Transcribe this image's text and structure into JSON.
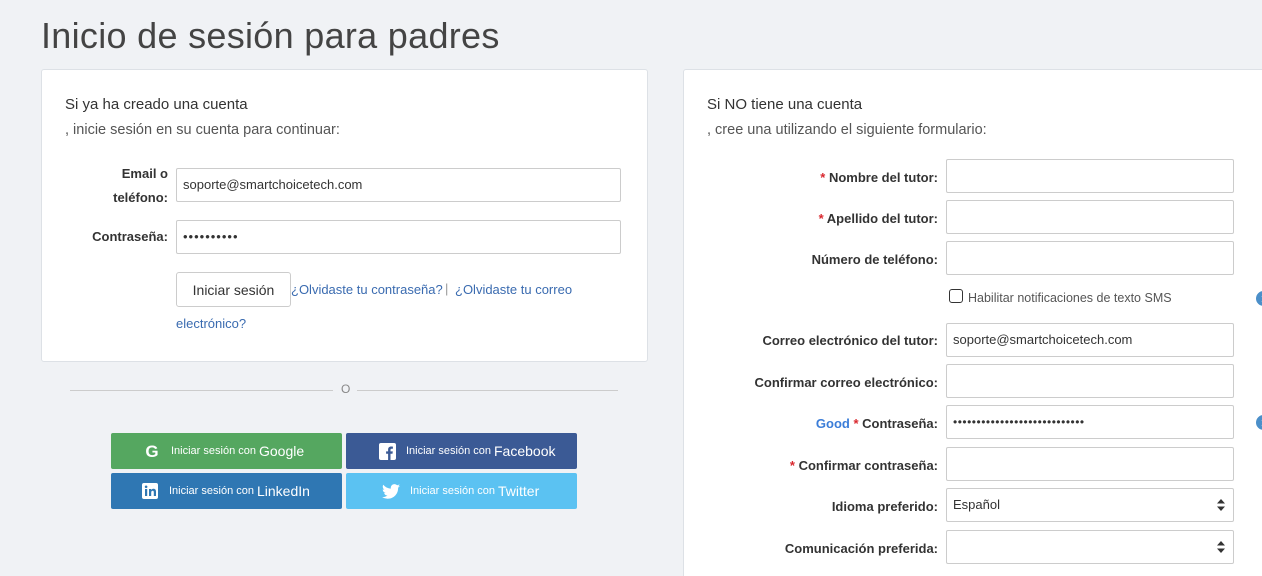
{
  "page": {
    "title": "Inicio de sesión para padres"
  },
  "login": {
    "intro_line1": "Si ya ha creado una cuenta",
    "intro_line2": ", inicie sesión en su cuenta para continuar:",
    "email_label_1": "Email o",
    "email_label_2": "teléfono:",
    "email_value": "soporte@smartchoicetech.com",
    "password_label": "Contraseña:",
    "password_value": "••••••••••",
    "submit_label": "Iniciar sesión",
    "forgot_password": "¿Olvidaste tu contraseña?",
    "separator": "|",
    "forgot_email_1": "¿Olvidaste tu correo",
    "forgot_email_2": "electrónico?"
  },
  "divider": {
    "text": "O"
  },
  "social": {
    "prefix": "Iniciar sesión con",
    "google": "Google",
    "facebook": "Facebook",
    "linkedin": "LinkedIn",
    "twitter": "Twitter",
    "colors": {
      "google": "#55a760",
      "facebook": "#3b5a95",
      "linkedin": "#2f77b3",
      "twitter": "#5bc2f2"
    }
  },
  "register": {
    "intro_line1": "Si NO tiene una cuenta",
    "intro_line2": ", cree una utilizando el siguiente formulario:",
    "required_mark": "*",
    "first_name_label": "Nombre del tutor:",
    "last_name_label": "Apellido del tutor:",
    "phone_label": "Número de teléfono:",
    "sms_label": "Habilitar notificaciones de texto SMS",
    "email_label": "Correo electrónico del tutor:",
    "email_value": "soporte@smartchoicetech.com",
    "confirm_email_label": "Confirmar correo electrónico:",
    "password_strength": "Good",
    "password_label": "Contraseña:",
    "password_value": "••••••••••••••••••••••••••••",
    "confirm_password_label": "Confirmar contraseña:",
    "language_label": "Idioma preferido:",
    "language_value": "Español",
    "communication_label": "Comunicación preferida:",
    "communication_value": "",
    "info_glyph": "i"
  }
}
